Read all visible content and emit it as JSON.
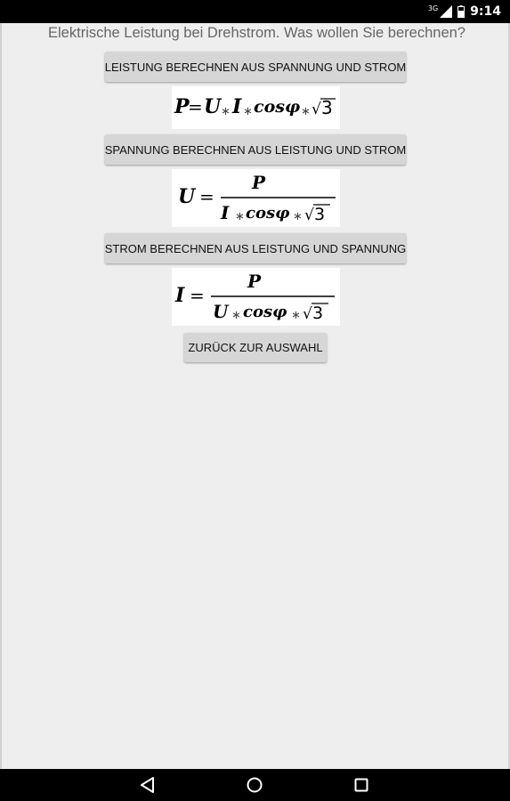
{
  "status_bar": {
    "network": "3G",
    "time": "9:14"
  },
  "header": {
    "text": "Elektrische Leistung bei Drehstrom. Was wollen Sie berechnen?"
  },
  "buttons": {
    "power": "LEISTUNG BERECHNEN AUS SPANNUNG UND STROM",
    "voltage": "SPANNUNG BERECHNEN AUS LEISTUNG UND STROM",
    "current": "STROM BERECHNEN AUS LEISTUNG UND SPANNUNG",
    "back": "ZURÜCK ZUR AUSWAHL"
  },
  "formulas": {
    "power": {
      "lhs": "P",
      "eq": "=",
      "rhs_a": "U",
      "op": "∗",
      "rhs_b": "I",
      "cos": "cosφ",
      "sqrt_sign": "√",
      "sqrt_val": "3"
    },
    "voltage": {
      "lhs": "U",
      "eq": "=",
      "num": "P",
      "den_a": "I",
      "op": "∗",
      "cos": "cosφ",
      "sqrt_sign": "√",
      "sqrt_val": "3"
    },
    "current": {
      "lhs": "I",
      "eq": "=",
      "num": "P",
      "den_a": "U",
      "op": "∗",
      "cos": "cosφ",
      "sqrt_sign": "√",
      "sqrt_val": "3"
    }
  },
  "nav_bar": {
    "icons": [
      "back-icon",
      "home-icon",
      "recents-icon"
    ]
  },
  "colors": {
    "background": "#eeeeee",
    "button": "#d6d6d6",
    "header_text": "#666666",
    "bars": "#000000"
  }
}
